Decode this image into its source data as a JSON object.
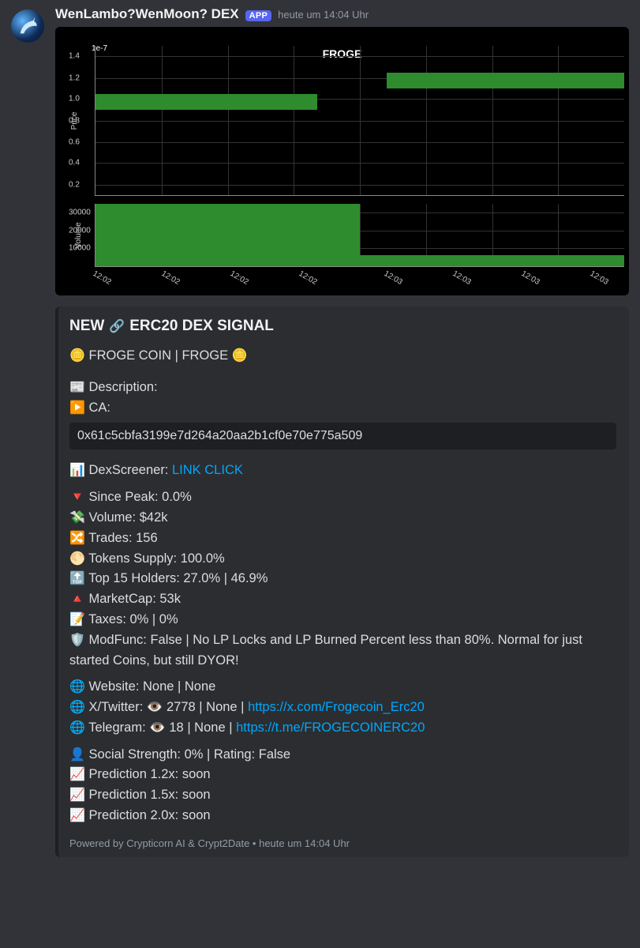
{
  "header": {
    "username": "WenLambo?WenMoon? DEX",
    "badge": "APP",
    "timestamp": "heute um 14:04 Uhr"
  },
  "chart_data": [
    {
      "type": "bar",
      "title": "FROGE",
      "ylabel": "Price",
      "y_exponent_label": "1e-7",
      "y_ticks": [
        0.2,
        0.4,
        0.6,
        0.8,
        1.0,
        1.2,
        1.4
      ],
      "ylim": [
        0.1,
        1.5
      ],
      "series": [
        {
          "x_label": "12:02",
          "low": 0.9,
          "high": 1.05
        },
        {
          "x_label": "12:03",
          "low": 1.1,
          "high": 1.25
        }
      ],
      "x_tick_labels": [
        "12:02",
        "12:02",
        "12:02",
        "12:02",
        "12:03",
        "12:03",
        "12:03",
        "12:03"
      ]
    },
    {
      "type": "bar",
      "ylabel": "Volume",
      "y_ticks": [
        10000,
        20000,
        30000
      ],
      "ylim": [
        0,
        35000
      ],
      "series": [
        {
          "x_label": "12:02",
          "value": 35000
        },
        {
          "x_label": "12:03",
          "value": 6000
        }
      ],
      "x_tick_labels": [
        "12:02",
        "12:02",
        "12:02",
        "12:02",
        "12:03",
        "12:03",
        "12:03",
        "12:03"
      ]
    }
  ],
  "embed": {
    "title_prefix": "NEW",
    "title_rest": "ERC20 DEX SIGNAL",
    "coin_line": "FROGE COIN | FROGE",
    "desc_label": "Description:",
    "ca_label": "CA:",
    "ca_value": "0x61c5cbfa3199e7d264a20aa2b1cf0e70e775a509",
    "dexscreener_label": "DexScreener:",
    "dexscreener_link": "LINK CLICK",
    "stats": {
      "since_peak": "Since Peak: 0.0%",
      "volume": "Volume: $42k",
      "trades": "Trades: 156",
      "supply": "Tokens Supply: 100.0%",
      "top15": "Top 15 Holders: 27.0% | 46.9%",
      "mcap": "MarketCap: 53k",
      "taxes": "Taxes: 0% | 0%",
      "modfunc": "ModFunc: False | No LP Locks and LP Burned Percent less than 80%. Normal for just started Coins, but still DYOR!"
    },
    "socials": {
      "website": "Website: None | None",
      "twitter_prefix": "X/Twitter: 👁️ 2778 | None | ",
      "twitter_link": "https://x.com/Frogecoin_Erc20",
      "telegram_prefix": "Telegram: 👁️ 18 | None | ",
      "telegram_link": "https://t.me/FROGECOINERC20"
    },
    "predictions": {
      "social": "Social Strength: 0% | Rating: False",
      "p12": "Prediction 1.2x: soon",
      "p15": "Prediction 1.5x: soon",
      "p20": "Prediction 2.0x: soon"
    },
    "footer": "Powered by Crypticorn AI & Crypt2Date  •  heute um 14:04 Uhr"
  }
}
